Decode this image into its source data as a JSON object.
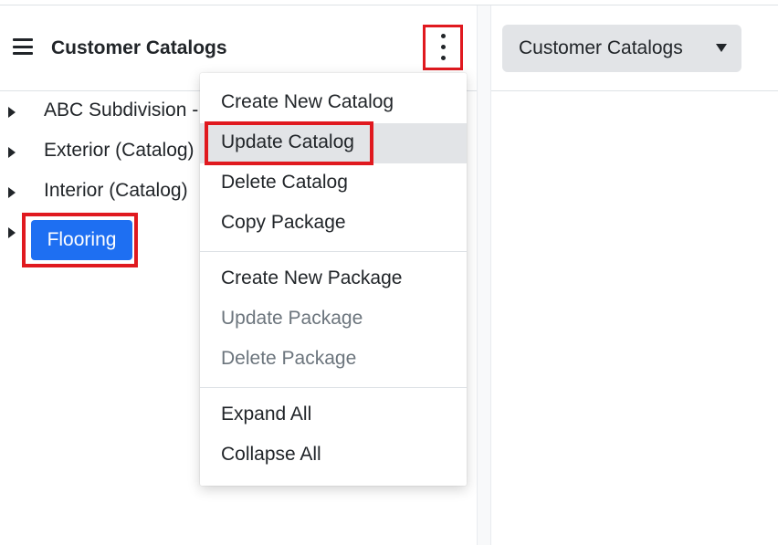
{
  "header": {
    "title": "Customer Catalogs"
  },
  "tree": {
    "items": [
      {
        "label": "ABC Subdivision - "
      },
      {
        "label": "Exterior (Catalog)"
      },
      {
        "label": "Interior (Catalog)"
      },
      {
        "label": "Flooring",
        "selected": true
      }
    ]
  },
  "menu": {
    "group1": [
      {
        "label": "Create New Catalog"
      },
      {
        "label": "Update Catalog",
        "highlighted": true
      },
      {
        "label": "Delete Catalog"
      },
      {
        "label": "Copy Package"
      }
    ],
    "group2": [
      {
        "label": "Create New Package"
      },
      {
        "label": "Update Package",
        "disabled": true
      },
      {
        "label": "Delete Package",
        "disabled": true
      }
    ],
    "group3": [
      {
        "label": "Expand All"
      },
      {
        "label": "Collapse All"
      }
    ]
  },
  "right": {
    "dropdown_label": "Customer Catalogs"
  },
  "icons": {
    "menu": "hamburger-icon",
    "more": "vertical-ellipsis-icon",
    "expand": "caret-right-icon",
    "dropdown": "caret-down-icon"
  },
  "colors": {
    "accent": "#1e6ff2",
    "annotation": "#e0191f",
    "menu_highlight": "#e2e4e7",
    "disabled_text": "#6c757d"
  }
}
